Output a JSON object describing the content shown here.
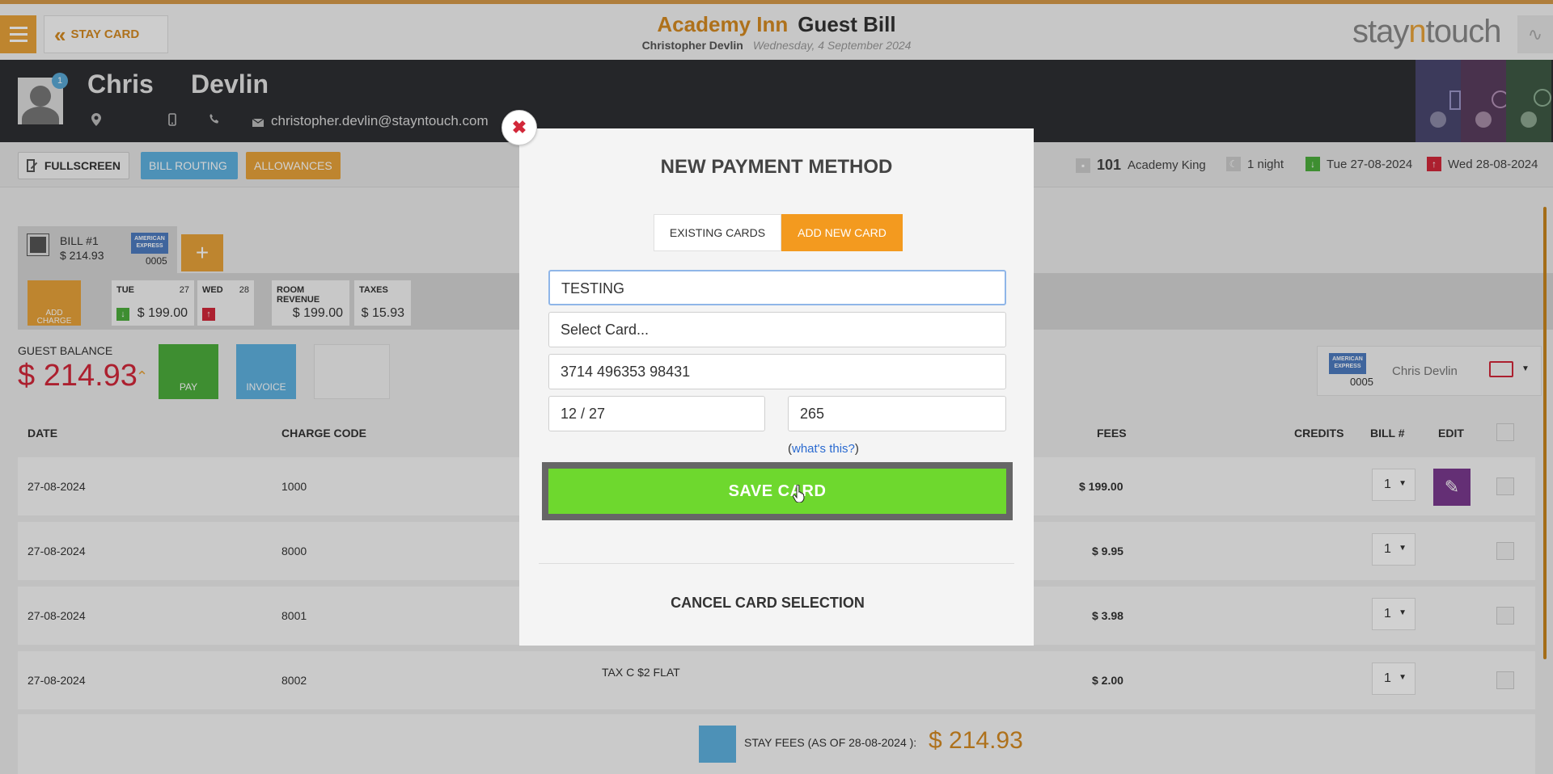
{
  "header": {
    "back_label": "STAY CARD",
    "hotel_name": "Academy Inn",
    "page_title": "Guest Bill",
    "guest_name": "Christopher Devlin",
    "date": "Wednesday, 4 September 2024",
    "logo_part1": "stay",
    "logo_part2": "n",
    "logo_part3": "touch"
  },
  "guest": {
    "first_name": "Chris",
    "last_name": "Devlin",
    "avatar_badge": "1",
    "email": "christopher.devlin@stayntouch.com"
  },
  "actions": {
    "fullscreen": "FULLSCREEN",
    "bill_routing": "BILL ROUTING",
    "allowances": "ALLOWANCES"
  },
  "reservation": {
    "room_number": "101",
    "room_type": "Academy King",
    "nights": "1 night",
    "arrival": "Tue 27-08-2024",
    "departure": "Wed 28-08-2024"
  },
  "bill": {
    "tab_label": "BILL #1",
    "tab_amount": "$ 214.93",
    "card_last4": "0005",
    "add_charge": "ADD CHARGE",
    "days": [
      {
        "name": "TUE",
        "num": "27",
        "value": "$ 199.00"
      },
      {
        "name": "WED",
        "num": "28",
        "value": ""
      }
    ],
    "room_revenue_label": "ROOM REVENUE",
    "room_revenue_value": "$ 199.00",
    "taxes_label": "TAXES",
    "taxes_value": "$ 15.93",
    "guest_balance_label": "GUEST BALANCE",
    "guest_balance_value": "$ 214.93",
    "pay_label": "PAY",
    "invoice_label": "INVOICE",
    "card_holder": "Chris Devlin",
    "card_num": "0005"
  },
  "table": {
    "headers": {
      "date": "DATE",
      "charge_code": "CHARGE CODE",
      "fees": "FEES",
      "credits": "CREDITS",
      "bill": "BILL #",
      "edit": "EDIT"
    },
    "rows": [
      {
        "date": "27-08-2024",
        "code": "1000",
        "desc": "",
        "fees": "$ 199.00",
        "bill": "1"
      },
      {
        "date": "27-08-2024",
        "code": "8000",
        "desc": "",
        "fees": "$ 9.95",
        "bill": "1"
      },
      {
        "date": "27-08-2024",
        "code": "8001",
        "desc": "",
        "fees": "$ 3.98",
        "bill": "1"
      },
      {
        "date": "27-08-2024",
        "code": "8002",
        "desc": "TAX C $2 FLAT",
        "fees": "$ 2.00",
        "bill": "1"
      }
    ],
    "stay_fees_label": "STAY FEES (AS OF  28-08-2024 ):",
    "stay_fees_value": "$ 214.93"
  },
  "modal": {
    "title": "NEW PAYMENT METHOD",
    "tab_existing": "EXISTING CARDS",
    "tab_new": "ADD NEW CARD",
    "name_value": "TESTING",
    "card_type_placeholder": "Select Card...",
    "card_number": "3714 496353 98431",
    "expiry": "12 / 27",
    "cvv": "265",
    "whats_this": "what's this?",
    "save_label": "SAVE CARD",
    "cancel_label": "CANCEL CARD SELECTION",
    "close_glyph": "✖"
  },
  "colors": {
    "accent_orange": "#e8a33a",
    "balance_red": "#d2283a",
    "save_green": "#6ed82e",
    "edit_purple": "#7b3a8f",
    "blue": "#5eb1e0"
  }
}
